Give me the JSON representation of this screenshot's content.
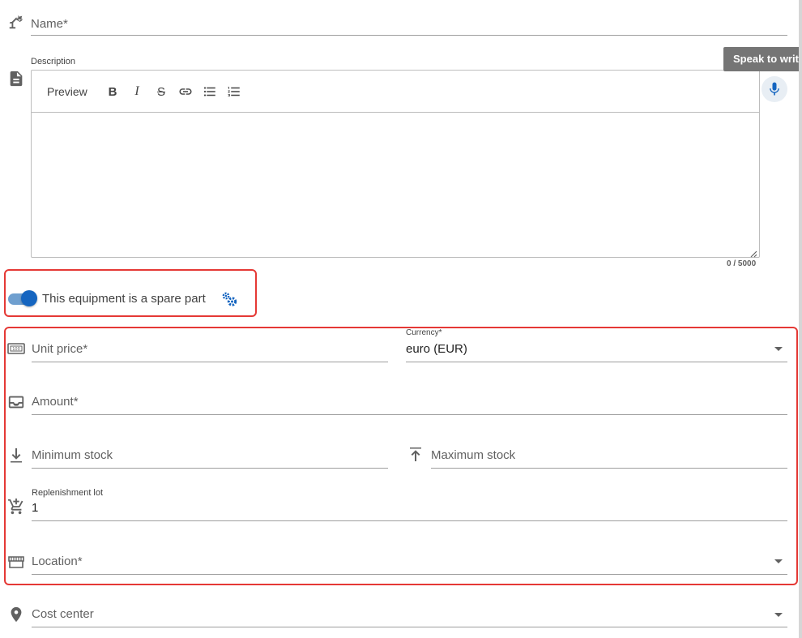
{
  "name_field": {
    "placeholder": "Name*"
  },
  "description": {
    "label": "Description",
    "preview_label": "Preview",
    "counter": "0 / 5000",
    "toolbar_icons": [
      "bold-icon",
      "italic-icon",
      "strikethrough-icon",
      "link-icon",
      "bulleted-list-icon",
      "numbered-list-icon"
    ]
  },
  "speech": {
    "tooltip": "Speak to write",
    "icon": "microphone-icon"
  },
  "spare_part": {
    "label": "This equipment is a spare part",
    "toggle_on": true,
    "settings_icon": "gears-icon"
  },
  "unit_price": {
    "placeholder": "Unit price*",
    "icon": "money-icon"
  },
  "currency": {
    "label": "Currency*",
    "value": "euro (EUR)"
  },
  "amount": {
    "placeholder": "Amount*",
    "icon": "inbox-icon"
  },
  "minimum_stock": {
    "placeholder": "Minimum stock",
    "icon": "arrow-down-bar-icon"
  },
  "maximum_stock": {
    "placeholder": "Maximum stock",
    "icon": "arrow-up-bar-icon"
  },
  "replenishment_lot": {
    "label": "Replenishment lot",
    "value": "1",
    "icon": "cart-plus-icon"
  },
  "location": {
    "placeholder": "Location*",
    "icon": "warehouse-icon"
  },
  "cost_center": {
    "placeholder": "Cost center",
    "icon": "map-marker-icon"
  },
  "colors": {
    "accent": "#1565c0",
    "highlight": "#e53935",
    "tooltip_bg": "#757575"
  }
}
